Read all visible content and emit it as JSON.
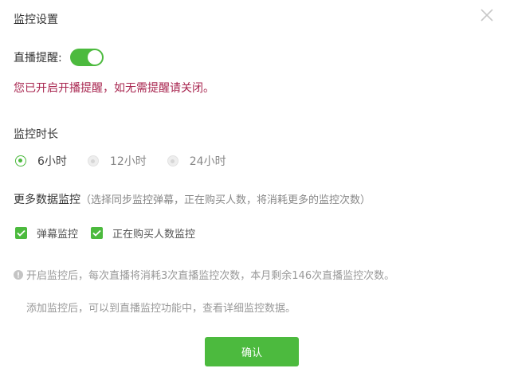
{
  "dialog": {
    "title": "监控设置"
  },
  "live_reminder": {
    "label": "直播提醒:",
    "enabled": true,
    "notice": "您已开启开播提醒，如无需提醒请关闭。"
  },
  "duration": {
    "label": "监控时长",
    "options": [
      {
        "label": "6小时",
        "selected": true
      },
      {
        "label": "12小时",
        "selected": false
      },
      {
        "label": "24小时",
        "selected": false
      }
    ]
  },
  "more_monitoring": {
    "title": "更多数据监控",
    "description": "（选择同步监控弹幕，正在购买人数，将消耗更多的监控次数）",
    "options": [
      {
        "label": "弹幕监控",
        "checked": true
      },
      {
        "label": "正在购买人数监控",
        "checked": true
      }
    ]
  },
  "info": {
    "line1": "开启监控后，每次直播将消耗3次直播监控次数，本月剩余146次直播监控次数。",
    "line2": "添加监控后，可以到直播监控功能中，查看详细监控数据。"
  },
  "confirm_label": "确认",
  "colors": {
    "accent": "#4cba3e",
    "notice": "#a8254f",
    "muted": "#999999"
  }
}
